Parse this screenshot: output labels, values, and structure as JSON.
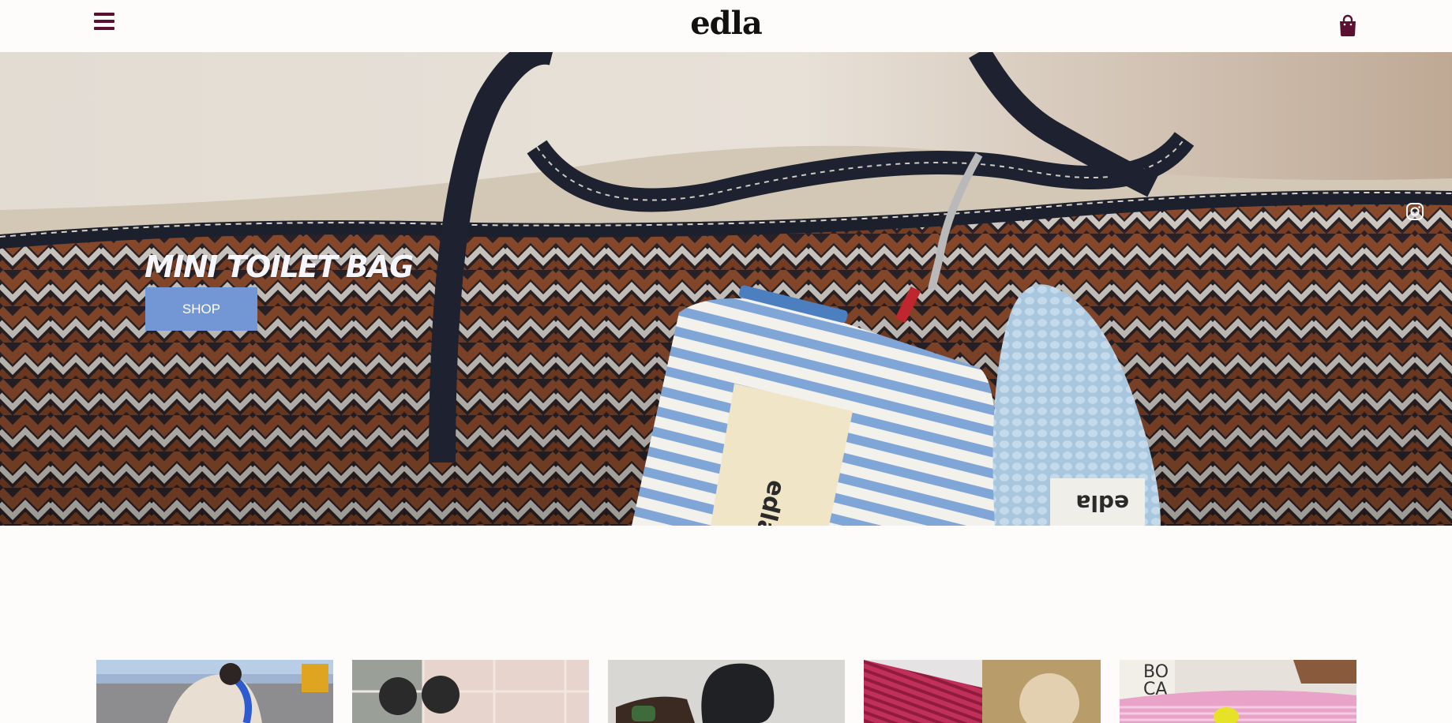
{
  "header": {
    "logo": "edla",
    "menu_icon": "hamburger-menu-icon",
    "cart_icon": "shopping-bag-icon",
    "accent_color": "#5a1030"
  },
  "hero": {
    "title": "MINI TOILET BAG",
    "button_label": "SHOP",
    "button_color": "#7396d4",
    "image": "mini-toilet-bag-hero-photo",
    "social_icon": "instagram-icon",
    "pouch_label": "edla",
    "crochet_label": "edla"
  },
  "products": [
    {
      "image": "product-photo-1"
    },
    {
      "image": "product-photo-2"
    },
    {
      "image": "product-photo-3"
    },
    {
      "image": "product-photo-4"
    },
    {
      "image": "product-photo-5"
    }
  ]
}
